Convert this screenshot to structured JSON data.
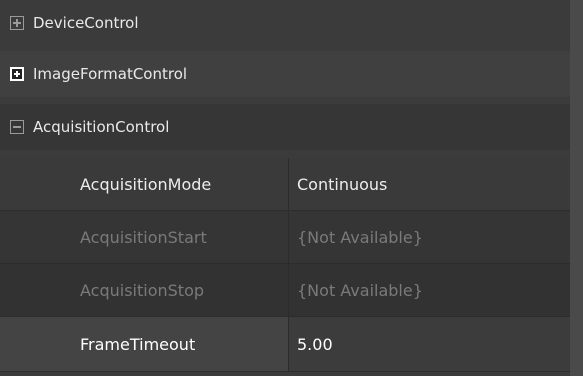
{
  "groups": [
    {
      "label": "DeviceControl",
      "expand_state": "collapsed"
    },
    {
      "label": "ImageFormatControl",
      "expand_state": "collapsed"
    },
    {
      "label": "AcquisitionControl",
      "expand_state": "expanded"
    }
  ],
  "properties": [
    {
      "name": "AcquisitionMode",
      "value": "Continuous",
      "enabled": true
    },
    {
      "name": "AcquisitionStart",
      "value": "{Not Available}",
      "enabled": false
    },
    {
      "name": "AcquisitionStop",
      "value": "{Not Available}",
      "enabled": false
    },
    {
      "name": "FrameTimeout",
      "value": "5.00",
      "enabled": true,
      "selected": true
    }
  ],
  "icons": {
    "collapsed": "expand-plus-icon",
    "expanded": "collapse-minus-icon"
  }
}
